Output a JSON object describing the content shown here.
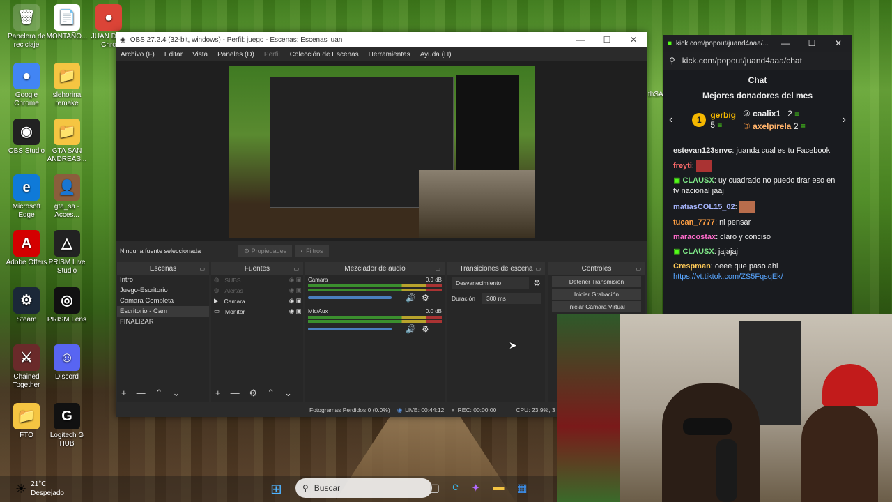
{
  "desktop": {
    "icons": [
      {
        "label": "Papelera de reciclaje",
        "glyph": "🗑"
      },
      {
        "label": "MONTAÑO...",
        "glyph": "📄"
      },
      {
        "label": "JUAN D... - Chro",
        "glyph": "●"
      },
      {
        "label": "Google Chrome",
        "glyph": "●"
      },
      {
        "label": "slehorina remake",
        "glyph": "📁"
      },
      {
        "label": "OBS Studio",
        "glyph": "◉"
      },
      {
        "label": "GTA SAN ANDREAS...",
        "glyph": "📁"
      },
      {
        "label": "Microsoft Edge",
        "glyph": "e"
      },
      {
        "label": "gta_sa - Acces...",
        "glyph": "👤"
      },
      {
        "label": "Adobe Offers",
        "glyph": "A"
      },
      {
        "label": "PRISM Live Studio",
        "glyph": "△"
      },
      {
        "label": "Steam",
        "glyph": "⚙"
      },
      {
        "label": "PRISM Lens",
        "glyph": "◎"
      },
      {
        "label": "Chained Together",
        "glyph": "⚔"
      },
      {
        "label": "Discord",
        "glyph": "☺"
      },
      {
        "label": "FTO",
        "glyph": "📁"
      },
      {
        "label": "Logitech G HUB",
        "glyph": "G"
      }
    ],
    "right_label": "thSA"
  },
  "obs": {
    "title": "OBS 27.2.4 (32-bit, windows) - Perfil: juego - Escenas: Escenas juan",
    "menu": [
      "Archivo (F)",
      "Editar",
      "Vista",
      "Paneles (D)",
      "Perfil",
      "Colección de Escenas",
      "Herramientas",
      "Ayuda (H)"
    ],
    "selection_text": "Ninguna fuente seleccionada",
    "properties_label": "Propiedades",
    "filters_label": "Filtros",
    "scenes": {
      "title": "Escenas",
      "items": [
        "Intro",
        "Juego-Escritorio",
        "Camara Completa",
        "Escritorio - Cam",
        "FINALIZAR"
      ]
    },
    "sources": {
      "title": "Fuentes",
      "items": [
        "SUBS",
        "Alertas",
        "Camara",
        "Monitor"
      ]
    },
    "mixer": {
      "title": "Mezclador de audio",
      "channels": [
        {
          "name": "Camara",
          "db": "0.0 dB"
        },
        {
          "name": "Mic/Aux",
          "db": "0.0 dB"
        }
      ]
    },
    "transitions": {
      "title": "Transiciones de escena",
      "selected": "Desvanecimiento",
      "duration_label": "Duración",
      "duration_value": "300 ms"
    },
    "controls": {
      "title": "Controles",
      "buttons": [
        "Detener Transmisión",
        "Iniciar Grabación",
        "Iniciar Cámara Virtual"
      ]
    },
    "status": {
      "dropped": "Fotogramas Perdidos 0 (0.0%)",
      "live": "LIVE: 00:44:12",
      "rec": "REC: 00:00:00",
      "cpu": "CPU: 23.9%, 3"
    }
  },
  "chat": {
    "window_title": "kick.com/popout/juand4aaa/...",
    "url": "kick.com/popout/juand4aaa/chat",
    "title": "Chat",
    "donors_title": "Mejores donadores del mes",
    "donors": [
      {
        "name": "gerbig",
        "count": "5"
      },
      {
        "name": "caalix1",
        "count": "2"
      },
      {
        "name": "axelpirela",
        "count": "2"
      }
    ],
    "messages": [
      {
        "user": "estevan123snvc",
        "text": "juanda cual es tu Facebook",
        "color": "#e8e8e8"
      },
      {
        "user": "freyti",
        "text": "",
        "color": "#ff6b6b"
      },
      {
        "user": "CLAUSX",
        "text": "uy cuadrado no puedo tirar eso en tv nacional jaaj",
        "color": "#7ee787"
      },
      {
        "user": "matiasCOL15_02",
        "text": "",
        "color": "#a5b4fc"
      },
      {
        "user": "tucan_7777",
        "text": "ni pensar",
        "color": "#ff9f43"
      },
      {
        "user": "maracostax",
        "text": "claro y conciso",
        "color": "#ff6bcb"
      },
      {
        "user": "CLAUSX",
        "text": "jajajaj",
        "color": "#7ee787"
      },
      {
        "user": "Crespman",
        "text": "oeee que paso ahi",
        "color": "#feca57"
      }
    ],
    "link": "https://vt.tiktok.com/ZS5FqsqEk/"
  },
  "taskbar": {
    "weather_temp": "21°C",
    "weather_desc": "Despejado",
    "search_placeholder": "Buscar"
  }
}
